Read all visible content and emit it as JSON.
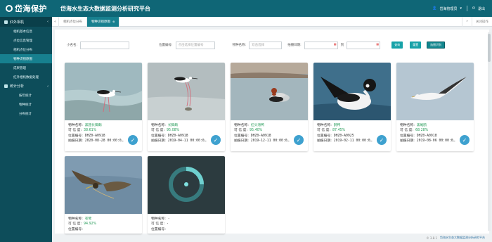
{
  "header": {
    "logo_text": "岱海保护",
    "platform_title": "岱海水生态大数据监测分析研究平台",
    "user_label": "岱海管理员",
    "logout_label": "退出"
  },
  "sidebar": {
    "section_title": "红外相机",
    "items": [
      {
        "label": "相机基本信息"
      },
      {
        "label": "点位信息管理"
      },
      {
        "label": "相机点位分布"
      },
      {
        "label": "物种识别原图"
      },
      {
        "label": "成果管理"
      },
      {
        "label": "红外相机数据处理"
      }
    ],
    "group_title": "统计分析",
    "sub_items": [
      {
        "label": "按年统计"
      },
      {
        "label": "物种统计"
      },
      {
        "label": "分布统计"
      }
    ]
  },
  "tabs": {
    "items": [
      {
        "label": "相机点位分布"
      },
      {
        "label": "物种识别原图"
      }
    ],
    "tools_label": "关闭操作"
  },
  "filters": {
    "name_label": "小名名:",
    "location_label": "位置编号:",
    "location_placeholder": "点击选择位置编号",
    "species_label": "物种名称:",
    "species_placeholder": "双击选择",
    "date_label": "拍摄日期:",
    "date_to": "到",
    "search_button": "查询",
    "reset_button": "重置",
    "extra_button": "选图识别"
  },
  "cards": [
    {
      "name_label": "物种名称:",
      "name": "黑翅长脚鹬",
      "conf_label": "可 信 度:",
      "conf": "38.61%",
      "loc_label": "位置编号:",
      "loc": "DHZ0-A0918",
      "date_label": "拍摄日期:",
      "date": "2020-08-28 00:00:0…"
    },
    {
      "name_label": "物种名称:",
      "name": "长脚鹬",
      "conf_label": "可 信 度:",
      "conf": "95.08%",
      "loc_label": "位置编号:",
      "loc": "DHZ0-A0918",
      "date_label": "拍摄日期:",
      "date": "2019-04-11 00:00:0…"
    },
    {
      "name_label": "物种名称:",
      "name": "红头潜鸭",
      "conf_label": "可 信 度:",
      "conf": "95.40%",
      "loc_label": "位置编号:",
      "loc": "DHZ0-A0918",
      "date_label": "拍摄日期:",
      "date": "2019-12-11 00:00:0…"
    },
    {
      "name_label": "物种名称:",
      "name": "鹊鸭",
      "conf_label": "可 信 度:",
      "conf": "87.45%",
      "loc_label": "位置编号:",
      "loc": "DHZ0-A0925",
      "date_label": "拍摄日期:",
      "date": "2019-02-11 00:00:0…"
    },
    {
      "name_label": "物种名称:",
      "name": "黑尾鸥",
      "conf_label": "可 信 度:",
      "conf": "68.28%",
      "loc_label": "位置编号:",
      "loc": "DHZ0-A0918",
      "date_label": "拍摄日期:",
      "date": "2019-08-06 00:00:0…"
    },
    {
      "name_label": "物种名称:",
      "name": "苍鹭",
      "conf_label": "可 信 度:",
      "conf": "94.92%",
      "loc_label": "位置编号:",
      "loc": "",
      "date_label": "",
      "date": ""
    },
    {
      "name_label": "物种名称:",
      "name": "-",
      "conf_label": "可 信 度:",
      "conf": "-",
      "loc_label": "位置编号:",
      "loc": "",
      "date_label": "",
      "date": ""
    }
  ],
  "footer": {
    "version": "© 3.8.1",
    "brand": "岱海水生态大数据监测分析研究平台"
  },
  "colors": {
    "header": "#0f6676",
    "sidebar": "#0d4d5a",
    "accent": "#17a2a8",
    "check": "#3ea1cf"
  }
}
